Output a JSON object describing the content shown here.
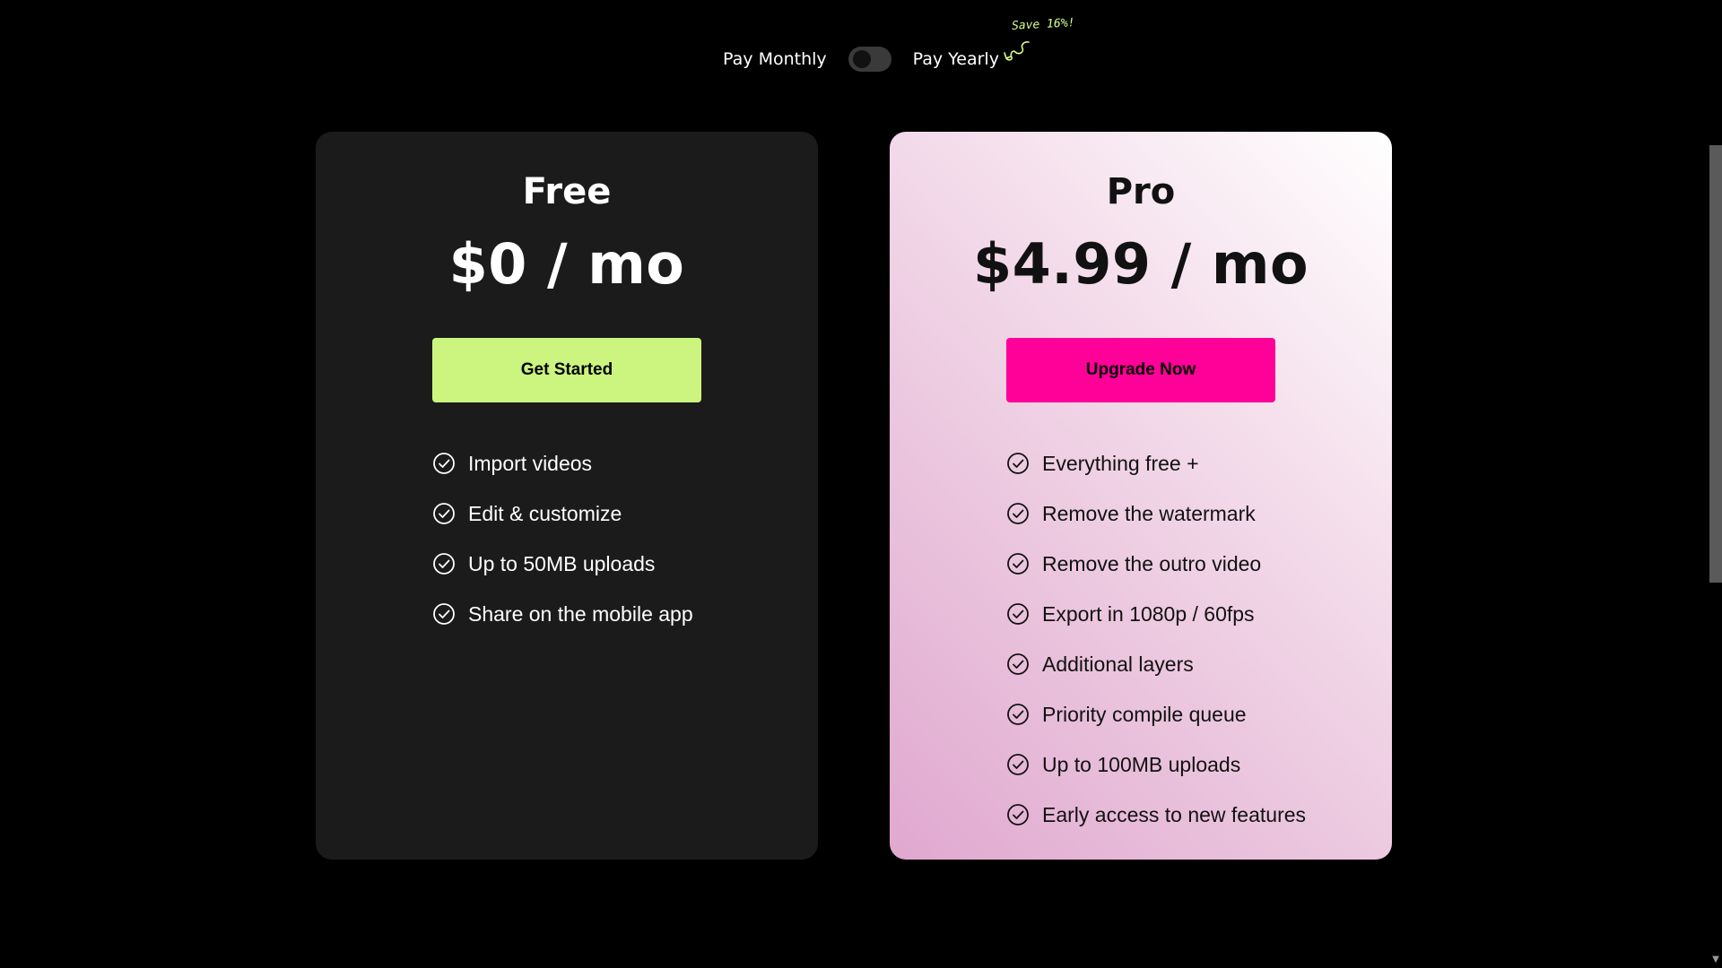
{
  "billing": {
    "monthly_label": "Pay Monthly",
    "yearly_label": "Pay Yearly",
    "save_note": "Save 16%!",
    "toggle_state": "monthly"
  },
  "plans": [
    {
      "name": "Free",
      "price": "$0 / mo",
      "cta": "Get Started",
      "features": [
        "Import videos",
        "Edit & customize",
        "Up to 50MB uploads",
        "Share on the mobile app"
      ]
    },
    {
      "name": "Pro",
      "price": "$4.99 / mo",
      "cta": "Upgrade Now",
      "features": [
        "Everything free +",
        "Remove the watermark",
        "Remove the outro video",
        "Export in 1080p / 60fps",
        "Additional layers",
        "Priority compile queue",
        "Up to 100MB uploads",
        "Early access to new features"
      ]
    }
  ],
  "icons": {
    "feature": "check-circle-icon",
    "note": "squiggle-arrow-icon"
  },
  "colors": {
    "background": "#000000",
    "free_card": "#1b1b1b",
    "free_cta": "#ccf57f",
    "pro_cta": "#ff0099",
    "save_note": "#d8ff8a"
  }
}
